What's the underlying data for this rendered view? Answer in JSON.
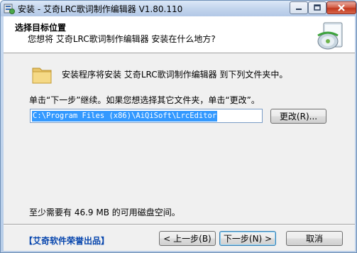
{
  "window": {
    "title": "安装 - 艾奇LRC歌词制作编辑器 V1.80.110",
    "minimize_symbol": "—",
    "maximize_symbol": "☐",
    "close_symbol": "✕"
  },
  "header": {
    "title": "选择目标位置",
    "subtitle": "您想将 艾奇LRC歌词制作编辑器 安装在什么地方?"
  },
  "body": {
    "install_message": "安装程序将安装 艾奇LRC歌词制作编辑器 到下列文件夹中。",
    "instruction": "单击“下一步”继续。如果您想选择其它文件夹，单击“更改”。",
    "path_value": "C:\\Program Files (x86)\\AiQiSoft\\LrcEditor",
    "browse_label": "更改(R)...",
    "space_required": "至少需要有 46.9 MB 的可用磁盘空间。"
  },
  "footer": {
    "brand": "【艾奇软件荣誉出品】",
    "back_label": "< 上一步(B)",
    "next_label": "下一步(N) >",
    "cancel_label": "取消"
  },
  "icons": {
    "app": "installer-app-icon",
    "header": "disc-install-icon",
    "folder": "folder-icon"
  },
  "colors": {
    "selection": "#3399ff",
    "brand_link": "#0645ad",
    "close_button": "#c2391f"
  }
}
